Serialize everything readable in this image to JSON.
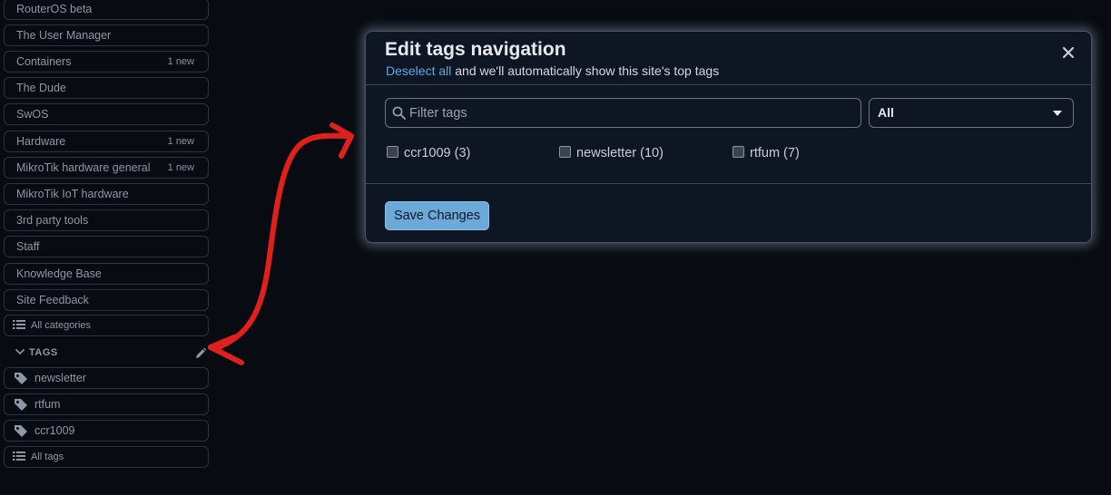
{
  "sidebar": {
    "categories": [
      {
        "label": "RouterOS beta",
        "badge": ""
      },
      {
        "label": "The User Manager",
        "badge": ""
      },
      {
        "label": "Containers",
        "badge": "1 new"
      },
      {
        "label": "The Dude",
        "badge": ""
      },
      {
        "label": "SwOS",
        "badge": ""
      },
      {
        "label": "Hardware",
        "badge": "1 new"
      },
      {
        "label": "MikroTik hardware general",
        "badge": "1 new"
      },
      {
        "label": "MikroTik IoT hardware",
        "badge": ""
      },
      {
        "label": "3rd party tools",
        "badge": ""
      },
      {
        "label": "Staff",
        "badge": ""
      },
      {
        "label": "Knowledge Base",
        "badge": ""
      },
      {
        "label": "Site Feedback",
        "badge": ""
      }
    ],
    "all_categories_label": "All categories",
    "tags_heading": "TAGS",
    "tags": [
      "newsletter",
      "rtfum",
      "ccr1009"
    ],
    "all_tags_label": "All tags"
  },
  "modal": {
    "title": "Edit tags navigation",
    "deselect_link": "Deselect all",
    "subtitle_rest": " and we'll automatically show this site's top tags",
    "filter_placeholder": "Filter tags",
    "select_value": "All",
    "checkboxes": [
      {
        "label": "ccr1009 (3)"
      },
      {
        "label": "newsletter (10)"
      },
      {
        "label": "rtfum (7)"
      }
    ],
    "save_label": "Save Changes"
  },
  "colors": {
    "accent": "#6aa9d8",
    "link": "#5fa8e0",
    "annotation": "#e0201c",
    "background": "#080b12"
  }
}
